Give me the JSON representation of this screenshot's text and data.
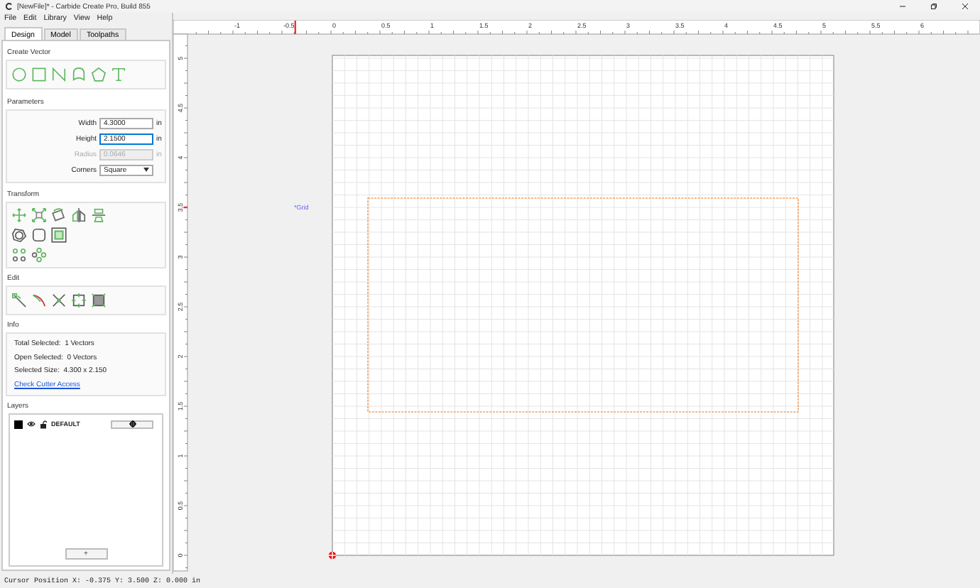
{
  "window": {
    "title": "[NewFile]* - Carbide Create Pro, Build 855"
  },
  "menu": [
    "File",
    "Edit",
    "Library",
    "View",
    "Help"
  ],
  "tabs": [
    {
      "label": "Design",
      "selected": true
    },
    {
      "label": "Model",
      "selected": false
    },
    {
      "label": "Toolpaths",
      "selected": false
    }
  ],
  "create_vector": {
    "title": "Create Vector"
  },
  "parameters": {
    "title": "Parameters",
    "fields": [
      {
        "label": "Width",
        "value": "4.3000",
        "unit": "in",
        "focused": false,
        "disabled": false
      },
      {
        "label": "Height",
        "value": "2.1500",
        "unit": "in",
        "focused": true,
        "disabled": false
      },
      {
        "label": "Radius",
        "value": "0.0646",
        "unit": "in",
        "focused": false,
        "disabled": true
      }
    ],
    "corners": {
      "label": "Corners",
      "value": "Square"
    }
  },
  "transform": {
    "title": "Transform"
  },
  "edit": {
    "title": "Edit"
  },
  "info": {
    "title": "Info",
    "lines": [
      "Total Selected:  1 Vectors",
      "Open Selected:  0 Vectors",
      "Selected Size:  4.300 x 2.150"
    ],
    "link": "Check Cutter Access"
  },
  "layers": {
    "title": "Layers",
    "items": [
      {
        "name": "DEFAULT",
        "color": "#000000",
        "visible": true,
        "locked": false
      }
    ],
    "add_button": "+"
  },
  "ruler": {
    "top_labels": [
      "-1",
      "-0.5",
      "0",
      "0.5",
      "1",
      "1.5",
      "2",
      "2.5",
      "3",
      "3.5",
      "4",
      "4.5",
      "5",
      "5.5",
      "6"
    ],
    "side_labels": [
      "5",
      "4.5",
      "4",
      "3.5",
      "3",
      "2.5",
      "2",
      "1.5",
      "1",
      "0.5",
      "0"
    ]
  },
  "canvas": {
    "grid_label": "*Grid"
  },
  "status_bar": "Cursor Position X: -0.375 Y: 3.500 Z: 0.000 in"
}
